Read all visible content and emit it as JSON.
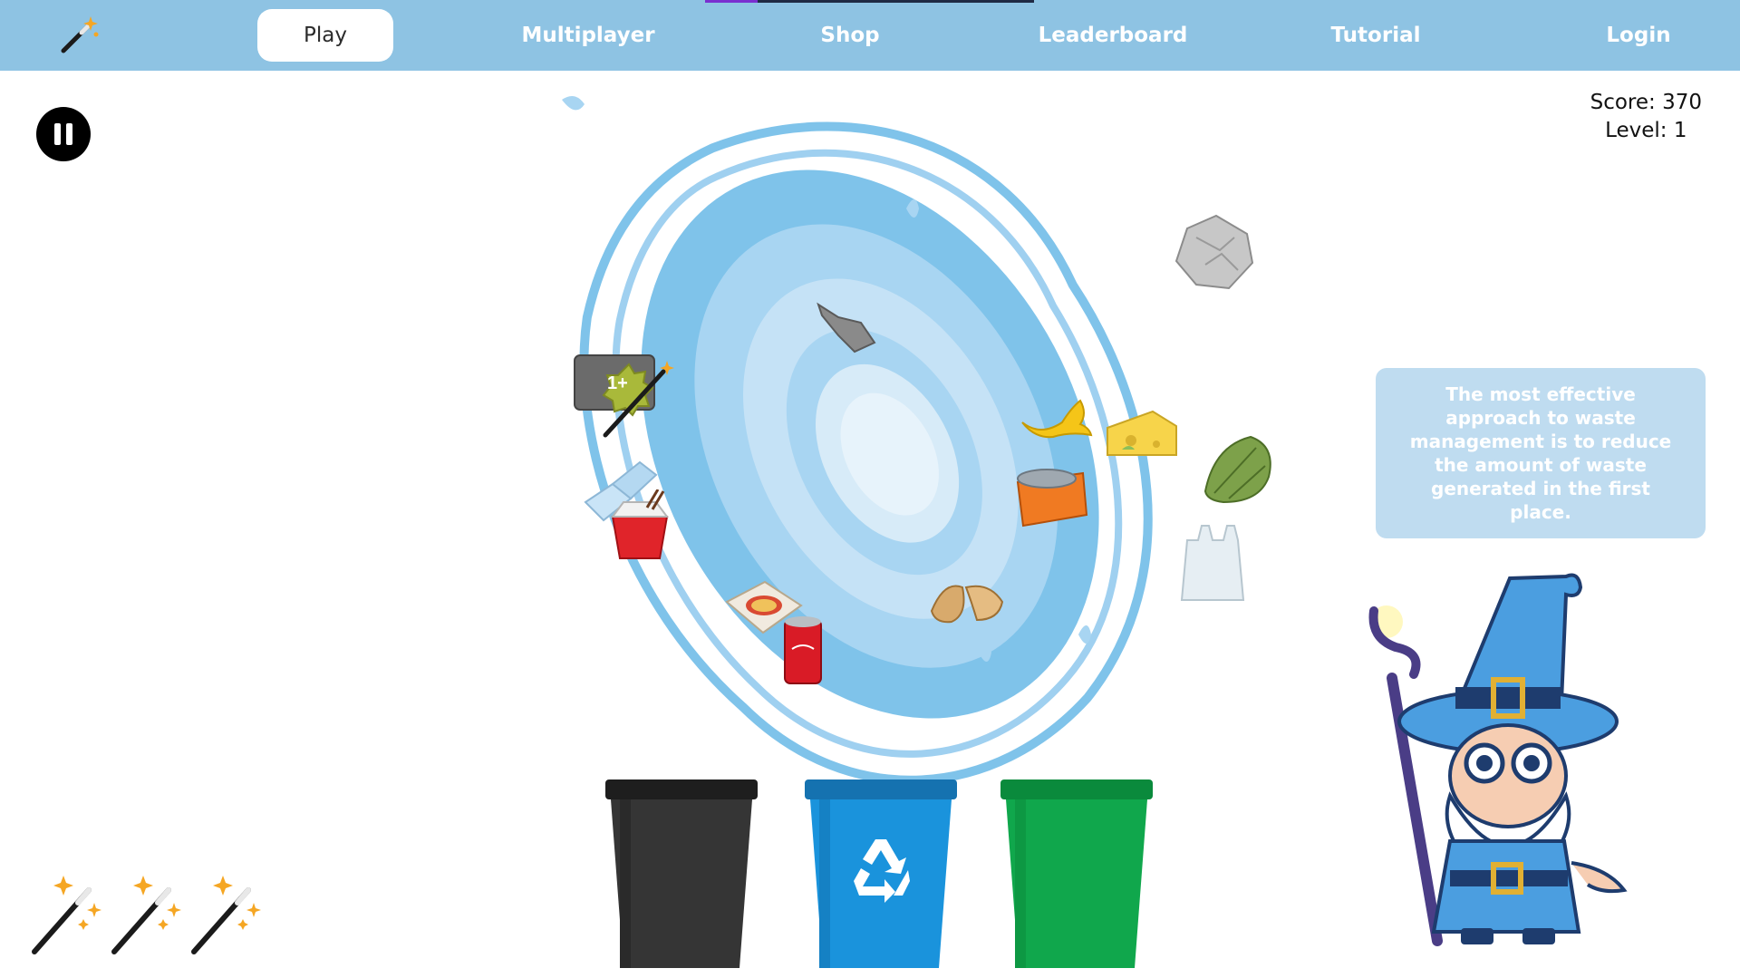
{
  "nav": {
    "items": [
      {
        "label": "Play",
        "active": true
      },
      {
        "label": "Multiplayer",
        "active": false
      },
      {
        "label": "Shop",
        "active": false
      },
      {
        "label": "Leaderboard",
        "active": false
      },
      {
        "label": "Tutorial",
        "active": false
      },
      {
        "label": "Login",
        "active": false
      }
    ],
    "logo_icon": "magic-wand-icon",
    "progress_fraction": 0.16
  },
  "hud": {
    "score_text": "Score: 370",
    "level_text": "Level: 1"
  },
  "pause_icon": "pause-icon",
  "tip": {
    "text": "The most effective approach to waste management is to reduce the amount of waste generated in the first place."
  },
  "powerup": {
    "badge_text": "1+"
  },
  "bins": [
    {
      "name": "general-waste-bin",
      "color": "#353535"
    },
    {
      "name": "recycling-bin",
      "color": "#1a93dc",
      "icon": "recycle-icon"
    },
    {
      "name": "organic-bin",
      "color": "#10a74c"
    }
  ],
  "waste_items": [
    "broken-bottle",
    "crumpled-paper",
    "banana-peel",
    "cheese",
    "lettuce",
    "crushed-can",
    "plastic-bag",
    "potato-peel",
    "plastic-bottles",
    "takeout-box",
    "pizza-box",
    "soda-can"
  ],
  "wands_remaining": 3,
  "colors": {
    "navbar": "#8ec3e3",
    "portal_light": "#c5e2f6",
    "portal_mid": "#7fc3ea",
    "tip_box": "#bfdcf0"
  }
}
